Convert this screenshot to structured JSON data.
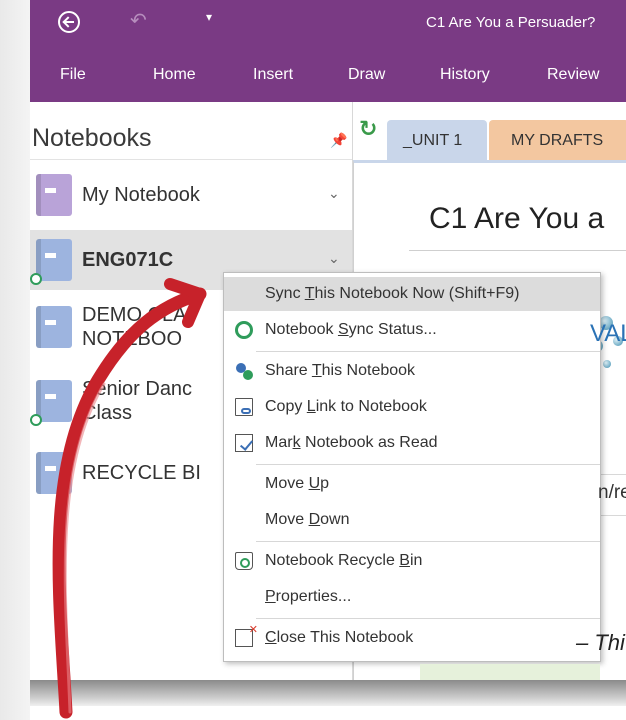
{
  "window": {
    "title": "C1 Are You a Persuader?",
    "undo_glyph": "↶",
    "qat_more_glyph": "▾"
  },
  "ribbon": {
    "tabs": [
      "File",
      "Home",
      "Insert",
      "Draw",
      "History",
      "Review"
    ]
  },
  "notebooks_pane": {
    "title": "Notebooks",
    "pin_glyph": "📌",
    "chevron_glyph": "⌄",
    "notebooks": [
      {
        "label_lines": [
          "My Notebook"
        ],
        "color": "#b9a3d8",
        "chevron": true,
        "bold": false,
        "synced": false
      },
      {
        "label_lines": [
          "ENG071C"
        ],
        "color": "#9db4df",
        "chevron": true,
        "bold": true,
        "synced": true,
        "selected": true
      },
      {
        "label_lines": [
          "DEMO CLA",
          "NOTEBOO"
        ],
        "color": "#9db4df",
        "chevron": false,
        "bold": false,
        "synced": false
      },
      {
        "label_lines": [
          "Senior Danc",
          "Class"
        ],
        "color": "#9db4df",
        "chevron": false,
        "bold": false,
        "synced": true
      },
      {
        "label_lines": [
          "RECYCLE BI"
        ],
        "color": "#9db4df",
        "chevron": false,
        "bold": false,
        "synced": false
      }
    ]
  },
  "page": {
    "sync_glyph": "↻",
    "tabs": [
      "_UNIT 1",
      "MY DRAFTS"
    ],
    "title": "C1 Are You a",
    "heading_fragment": "VALT",
    "text_fragment": "n/ref",
    "italic_fragment": "– Thi"
  },
  "context_menu": {
    "items": [
      {
        "name": "sync-this-notebook-now",
        "pre": "Sync ",
        "u": "T",
        "post": "his Notebook Now  (Shift+F9)",
        "icon": "",
        "highlight": true
      },
      {
        "name": "notebook-sync-status",
        "pre": "Notebook ",
        "u": "S",
        "post": "ync Status...",
        "icon": "sync"
      },
      {
        "sep": true
      },
      {
        "name": "share-this-notebook",
        "pre": "Share ",
        "u": "T",
        "post": "his Notebook",
        "icon": "share"
      },
      {
        "name": "copy-link-to-notebook",
        "pre": "Copy ",
        "u": "L",
        "post": "ink to Notebook",
        "icon": "doc"
      },
      {
        "name": "mark-notebook-as-read",
        "pre": "Mar",
        "u": "k",
        "post": " Notebook as Read",
        "icon": "mark"
      },
      {
        "sep": true
      },
      {
        "name": "move-up",
        "pre": "Move ",
        "u": "U",
        "post": "p",
        "icon": ""
      },
      {
        "name": "move-down",
        "pre": "Move ",
        "u": "D",
        "post": "own",
        "icon": ""
      },
      {
        "sep": true
      },
      {
        "name": "notebook-recycle-bin",
        "pre": "Notebook Recycle ",
        "u": "B",
        "post": "in",
        "icon": "bin"
      },
      {
        "name": "properties",
        "pre": "",
        "u": "P",
        "post": "roperties...",
        "icon": ""
      },
      {
        "sep": true
      },
      {
        "name": "close-this-notebook",
        "pre": "",
        "u": "C",
        "post": "lose This Notebook",
        "icon": "close"
      }
    ]
  }
}
